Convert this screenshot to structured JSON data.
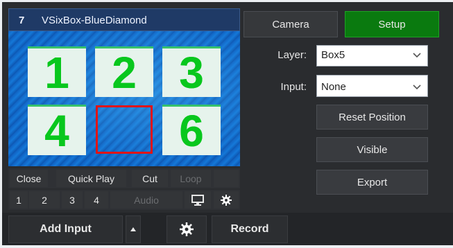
{
  "preview": {
    "number": "7",
    "title": "VSixBox-BlueDiamond",
    "boxes": [
      "1",
      "2",
      "3",
      "4",
      "",
      "6"
    ],
    "selected_box_index": 4
  },
  "controls": {
    "row1": [
      "Close",
      "Quick Play",
      "Cut",
      "Loop"
    ],
    "row2": [
      "1",
      "2",
      "3",
      "4"
    ],
    "audio": "Audio",
    "monitor_icon": "monitor-icon",
    "settings_icon": "gear-icon"
  },
  "tabs": {
    "camera": "Camera",
    "setup": "Setup"
  },
  "layer": {
    "label": "Layer:",
    "value": "Box5"
  },
  "input": {
    "label": "Input:",
    "value": "None"
  },
  "buttons": {
    "reset": "Reset Position",
    "visible": "Visible",
    "export": "Export"
  },
  "bottom": {
    "add_input": "Add Input",
    "record": "Record",
    "dropdown_icon": "caret-up-icon",
    "settings_icon": "gear-icon"
  },
  "colors": {
    "setup_active": "#0a7a0f",
    "header_blue": "#1f3a66",
    "selected_border": "#e11414",
    "number_green": "#08c71d"
  }
}
